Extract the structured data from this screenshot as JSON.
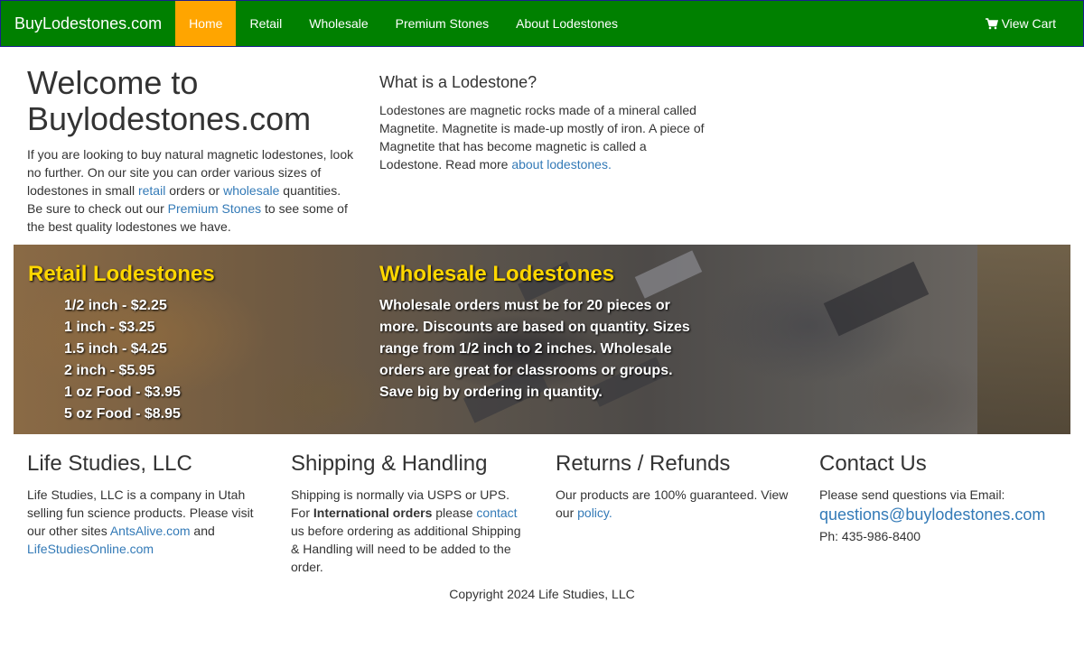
{
  "navbar": {
    "brand": "BuyLodestones.com",
    "items": [
      {
        "label": "Home",
        "active": true
      },
      {
        "label": "Retail",
        "active": false
      },
      {
        "label": "Wholesale",
        "active": false
      },
      {
        "label": "Premium Stones",
        "active": false
      },
      {
        "label": "About Lodestones",
        "active": false
      }
    ],
    "cart_label": "View Cart",
    "cart_icon": "shopping-cart-icon",
    "bg_color": "#008000",
    "active_color": "#ffa500"
  },
  "welcome": {
    "title": "Welcome to Buylodestones.com",
    "text_1": "If you are looking to buy natural magnetic lodestones, look no further. On our site you can order various sizes of lodestones in small ",
    "link_retail": "retail",
    "text_2": " orders or ",
    "link_wholesale": "wholesale",
    "text_3": " quantities. Be sure to check out our ",
    "link_premium": "Premium Stones",
    "text_4": " to see some of the best quality lodestones we have."
  },
  "what": {
    "title": "What is a Lodestone?",
    "text": "Lodestones are magnetic rocks made of a mineral called Magnetite. Magnetite is made-up mostly of iron. A piece of Magnetite that has become magnetic is called a Lodestone. Read more ",
    "link": "about lodestones."
  },
  "banner": {
    "retail_title": "Retail Lodestones",
    "retail_items": [
      "1/2 inch - $2.25",
      "1 inch - $3.25",
      "1.5 inch - $4.25",
      "2 inch - $5.95",
      "1 oz Food - $3.95",
      "5 oz Food - $8.95"
    ],
    "wholesale_title": "Wholesale Lodestones",
    "wholesale_text": "Wholesale orders must be for 20 pieces or more. Discounts are based on quantity. Sizes range from 1/2 inch to 2 inches. Wholesale orders are great for classrooms or groups. Save big by ordering in quantity.",
    "title_color": "#ffd700"
  },
  "footer": {
    "life": {
      "title": "Life Studies, LLC",
      "text_1": "Life Studies, LLC is a company in Utah selling fun science products. Please visit our other sites ",
      "link_1": "AntsAlive.com",
      "text_2": " and ",
      "link_2": "LifeStudiesOnline.com"
    },
    "shipping": {
      "title": "Shipping & Handling",
      "text_1": "Shipping is normally via USPS or UPS. For ",
      "bold": "International orders",
      "text_2": " please ",
      "link": "contact",
      "text_3": " us before ordering as additional Shipping & Handling will need to be added to the order."
    },
    "returns": {
      "title": "Returns / Refunds",
      "text": "Our products are 100% guaranteed. View our ",
      "link": "policy."
    },
    "contact": {
      "title": "Contact Us",
      "text": "Please send questions via Email:",
      "email": "questions@buylodestones.com",
      "phone": "Ph: 435-986-8400"
    },
    "copyright": "Copyright 2024 Life Studies, LLC"
  }
}
